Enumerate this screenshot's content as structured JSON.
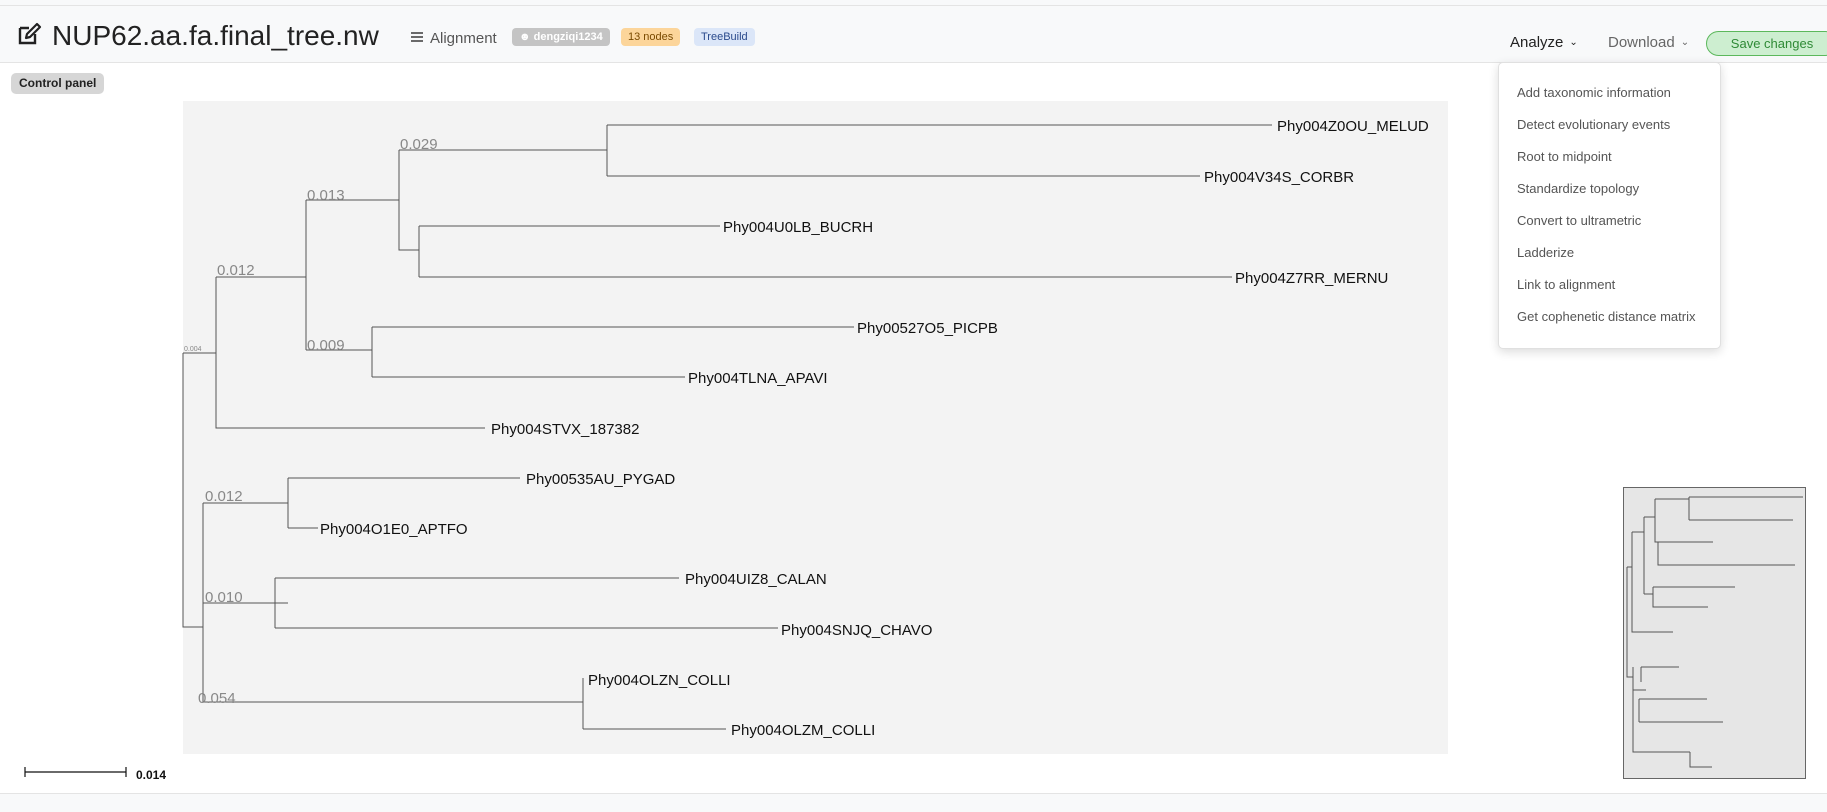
{
  "header": {
    "title": "NUP62.aa.fa.final_tree.nw",
    "alignment_label": "Alignment",
    "user_badge": "dengziqi1234",
    "nodes_badge": "13 nodes",
    "treebuild_badge": "TreeBuild",
    "analyze_label": "Analyze",
    "download_label": "Download",
    "save_label": "Save changes"
  },
  "control_panel": {
    "label": "Control panel"
  },
  "analyze_menu": {
    "items": [
      "Add taxonomic information",
      "Detect evolutionary events",
      "Root to midpoint",
      "Standardize topology",
      "Convert to ultrametric",
      "Ladderize",
      "Link to alignment",
      "Get cophenetic distance matrix"
    ]
  },
  "tree": {
    "leaves": [
      "Phy004Z0OU_MELUD",
      "Phy004V34S_CORBR",
      "Phy004U0LB_BUCRH",
      "Phy004Z7RR_MERNU",
      "Phy00527O5_PICPB",
      "Phy004TLNA_APAVI",
      "Phy004STVX_187382",
      "Phy00535AU_PYGAD",
      "Phy004O1E0_APTFO",
      "Phy004UIZ8_CALAN",
      "Phy004SNJQ_CHAVO",
      "Phy004OLZN_COLLI",
      "Phy004OLZM_COLLI"
    ],
    "branch_labels": [
      "0.029",
      "0.013",
      "0.012",
      "0.009",
      "0.004",
      "0.012",
      "0.010",
      "0.054"
    ]
  },
  "scale": {
    "label": "0.014"
  },
  "colors": {
    "save_border": "#5cb85c",
    "save_bg": "#cdeed0",
    "tree_bg": "#f3f3f3",
    "nodes_badge": "#fcd59a",
    "treebuild_badge": "#dbe6f8"
  }
}
